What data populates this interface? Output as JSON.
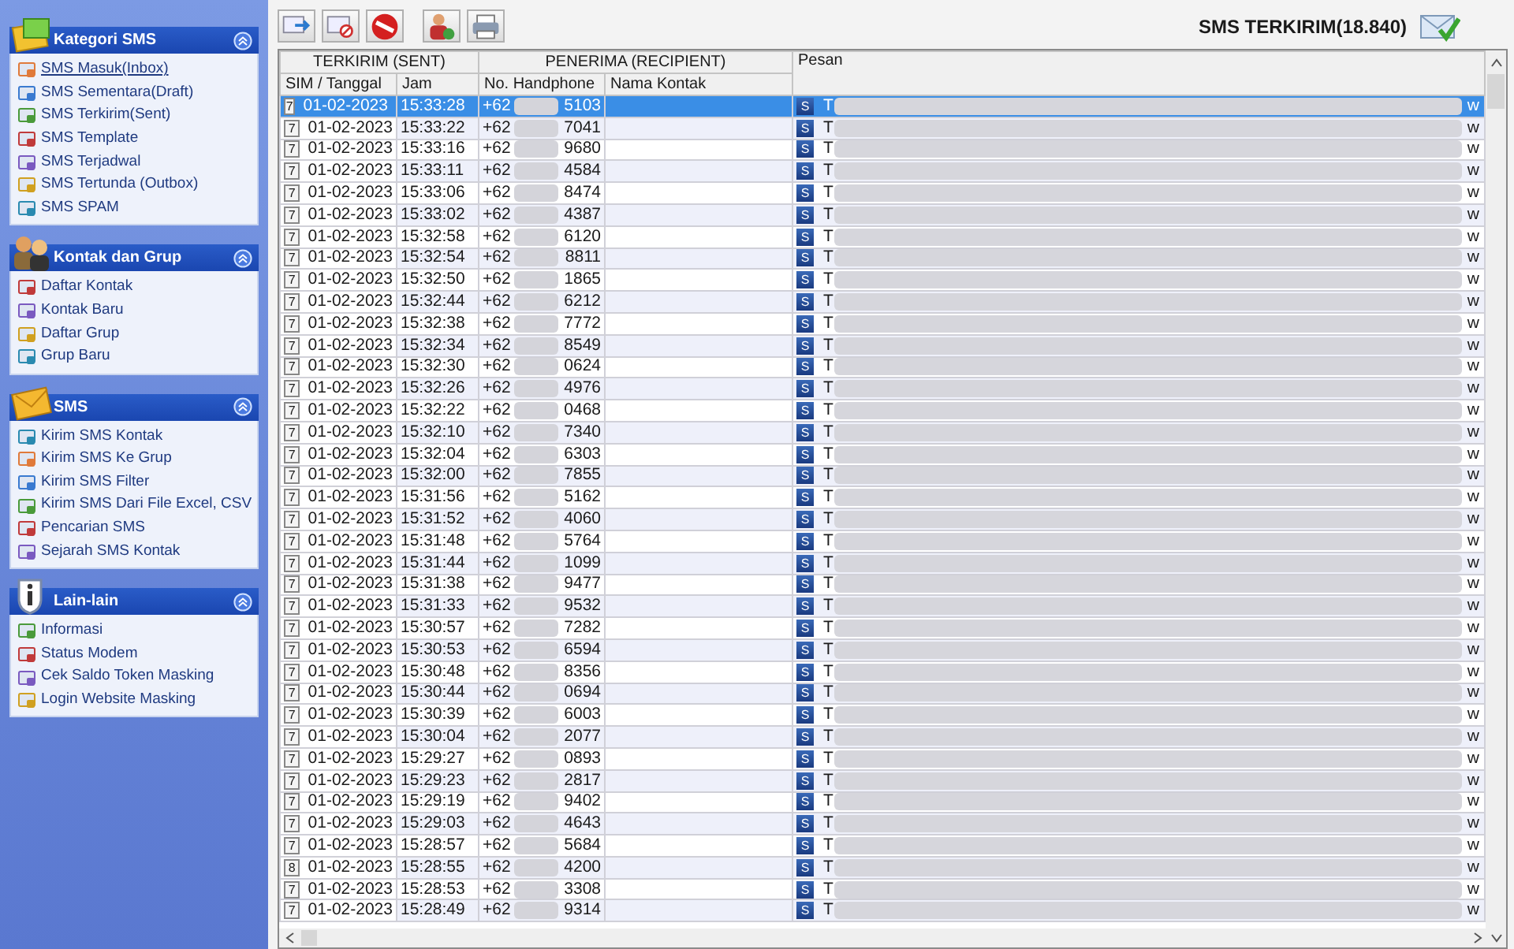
{
  "sidebar": {
    "sections": [
      {
        "title": "Kategori SMS",
        "expanded": true,
        "items": [
          {
            "label": "SMS Masuk(Inbox)",
            "selected": true
          },
          {
            "label": "SMS Sementara(Draft)",
            "selected": false
          },
          {
            "label": "SMS Terkirim(Sent)",
            "selected": false
          },
          {
            "label": "SMS Template",
            "selected": false
          },
          {
            "label": "SMS Terjadwal",
            "selected": false
          },
          {
            "label": "SMS Tertunda (Outbox)",
            "selected": false
          },
          {
            "label": "SMS SPAM",
            "selected": false
          }
        ]
      },
      {
        "title": "Kontak dan Grup",
        "expanded": true,
        "items": [
          {
            "label": "Daftar Kontak",
            "selected": false
          },
          {
            "label": "Kontak Baru",
            "selected": false
          },
          {
            "label": "Daftar Grup",
            "selected": false
          },
          {
            "label": "Grup Baru",
            "selected": false
          }
        ]
      },
      {
        "title": "SMS",
        "expanded": true,
        "items": [
          {
            "label": "Kirim SMS Kontak",
            "selected": false
          },
          {
            "label": "Kirim SMS Ke Grup",
            "selected": false
          },
          {
            "label": "Kirim SMS Filter",
            "selected": false
          },
          {
            "label": "Kirim SMS Dari File Excel, CSV",
            "selected": false
          },
          {
            "label": "Pencarian SMS",
            "selected": false
          },
          {
            "label": "Sejarah SMS Kontak",
            "selected": false
          }
        ]
      },
      {
        "title": "Lain-lain",
        "expanded": true,
        "items": [
          {
            "label": "Informasi",
            "selected": false
          },
          {
            "label": "Status Modem",
            "selected": false
          },
          {
            "label": "Cek Saldo Token Masking",
            "selected": false
          },
          {
            "label": "Login Website Masking",
            "selected": false
          }
        ]
      }
    ]
  },
  "header": {
    "title": "SMS TERKIRIM(18.840)"
  },
  "table": {
    "groups": [
      "TERKIRIM (SENT)",
      "PENERIMA (RECIPIENT)"
    ],
    "columns": [
      "SIM / Tanggal",
      "Jam",
      "No. Handphone",
      "Nama Kontak",
      "Pesan"
    ],
    "rows": [
      {
        "sim": "7",
        "date": "01-02-2023",
        "time": "15:33:28",
        "phone_start": "+62",
        "phone_end": "5103",
        "badge": "S",
        "message_start": "T",
        "message_end": "w",
        "selected": true
      },
      {
        "sim": "7",
        "date": "01-02-2023",
        "time": "15:33:22",
        "phone_start": "+62",
        "phone_end": "7041",
        "badge": "S",
        "message_start": "T",
        "message_end": "w",
        "selected": false
      },
      {
        "sim": "7",
        "date": "01-02-2023",
        "time": "15:33:16",
        "phone_start": "+62",
        "phone_end": "9680",
        "badge": "S",
        "message_start": "T",
        "message_end": "w",
        "selected": false
      },
      {
        "sim": "7",
        "date": "01-02-2023",
        "time": "15:33:11",
        "phone_start": "+62",
        "phone_end": "4584",
        "badge": "S",
        "message_start": "T",
        "message_end": "w",
        "selected": false
      },
      {
        "sim": "7",
        "date": "01-02-2023",
        "time": "15:33:06",
        "phone_start": "+62",
        "phone_end": "8474",
        "badge": "S",
        "message_start": "T",
        "message_end": "w",
        "selected": false
      },
      {
        "sim": "7",
        "date": "01-02-2023",
        "time": "15:33:02",
        "phone_start": "+62",
        "phone_end": "4387",
        "badge": "S",
        "message_start": "T",
        "message_end": "w",
        "selected": false
      },
      {
        "sim": "7",
        "date": "01-02-2023",
        "time": "15:32:58",
        "phone_start": "+62",
        "phone_end": "6120",
        "badge": "S",
        "message_start": "T",
        "message_end": "w",
        "selected": false
      },
      {
        "sim": "7",
        "date": "01-02-2023",
        "time": "15:32:54",
        "phone_start": "+62",
        "phone_end": "8811",
        "badge": "S",
        "message_start": "T",
        "message_end": "w",
        "selected": false
      },
      {
        "sim": "7",
        "date": "01-02-2023",
        "time": "15:32:50",
        "phone_start": "+62",
        "phone_end": "1865",
        "badge": "S",
        "message_start": "T",
        "message_end": "w",
        "selected": false
      },
      {
        "sim": "7",
        "date": "01-02-2023",
        "time": "15:32:44",
        "phone_start": "+62",
        "phone_end": "6212",
        "badge": "S",
        "message_start": "T",
        "message_end": "w",
        "selected": false
      },
      {
        "sim": "7",
        "date": "01-02-2023",
        "time": "15:32:38",
        "phone_start": "+62",
        "phone_end": "7772",
        "badge": "S",
        "message_start": "T",
        "message_end": "w",
        "selected": false
      },
      {
        "sim": "7",
        "date": "01-02-2023",
        "time": "15:32:34",
        "phone_start": "+62",
        "phone_end": "8549",
        "badge": "S",
        "message_start": "T",
        "message_end": "w",
        "selected": false
      },
      {
        "sim": "7",
        "date": "01-02-2023",
        "time": "15:32:30",
        "phone_start": "+62",
        "phone_end": "0624",
        "badge": "S",
        "message_start": "T",
        "message_end": "w",
        "selected": false
      },
      {
        "sim": "7",
        "date": "01-02-2023",
        "time": "15:32:26",
        "phone_start": "+62",
        "phone_end": "4976",
        "badge": "S",
        "message_start": "T",
        "message_end": "w",
        "selected": false
      },
      {
        "sim": "7",
        "date": "01-02-2023",
        "time": "15:32:22",
        "phone_start": "+62",
        "phone_end": "0468",
        "badge": "S",
        "message_start": "T",
        "message_end": "w",
        "selected": false
      },
      {
        "sim": "7",
        "date": "01-02-2023",
        "time": "15:32:10",
        "phone_start": "+62",
        "phone_end": "7340",
        "badge": "S",
        "message_start": "T",
        "message_end": "w",
        "selected": false
      },
      {
        "sim": "7",
        "date": "01-02-2023",
        "time": "15:32:04",
        "phone_start": "+62",
        "phone_end": "6303",
        "badge": "S",
        "message_start": "T",
        "message_end": "w",
        "selected": false
      },
      {
        "sim": "7",
        "date": "01-02-2023",
        "time": "15:32:00",
        "phone_start": "+62",
        "phone_end": "7855",
        "badge": "S",
        "message_start": "T",
        "message_end": "w",
        "selected": false
      },
      {
        "sim": "7",
        "date": "01-02-2023",
        "time": "15:31:56",
        "phone_start": "+62",
        "phone_end": "5162",
        "badge": "S",
        "message_start": "T",
        "message_end": "w",
        "selected": false
      },
      {
        "sim": "7",
        "date": "01-02-2023",
        "time": "15:31:52",
        "phone_start": "+62",
        "phone_end": "4060",
        "badge": "S",
        "message_start": "T",
        "message_end": "w",
        "selected": false
      },
      {
        "sim": "7",
        "date": "01-02-2023",
        "time": "15:31:48",
        "phone_start": "+62",
        "phone_end": "5764",
        "badge": "S",
        "message_start": "T",
        "message_end": "w",
        "selected": false
      },
      {
        "sim": "7",
        "date": "01-02-2023",
        "time": "15:31:44",
        "phone_start": "+62",
        "phone_end": "1099",
        "badge": "S",
        "message_start": "T",
        "message_end": "w",
        "selected": false
      },
      {
        "sim": "7",
        "date": "01-02-2023",
        "time": "15:31:38",
        "phone_start": "+62",
        "phone_end": "9477",
        "badge": "S",
        "message_start": "T",
        "message_end": "w",
        "selected": false
      },
      {
        "sim": "7",
        "date": "01-02-2023",
        "time": "15:31:33",
        "phone_start": "+62",
        "phone_end": "9532",
        "badge": "S",
        "message_start": "T",
        "message_end": "w",
        "selected": false
      },
      {
        "sim": "7",
        "date": "01-02-2023",
        "time": "15:30:57",
        "phone_start": "+62",
        "phone_end": "7282",
        "badge": "S",
        "message_start": "T",
        "message_end": "w",
        "selected": false
      },
      {
        "sim": "7",
        "date": "01-02-2023",
        "time": "15:30:53",
        "phone_start": "+62",
        "phone_end": "6594",
        "badge": "S",
        "message_start": "T",
        "message_end": "w",
        "selected": false
      },
      {
        "sim": "7",
        "date": "01-02-2023",
        "time": "15:30:48",
        "phone_start": "+62",
        "phone_end": "8356",
        "badge": "S",
        "message_start": "T",
        "message_end": "w",
        "selected": false
      },
      {
        "sim": "7",
        "date": "01-02-2023",
        "time": "15:30:44",
        "phone_start": "+62",
        "phone_end": "0694",
        "badge": "S",
        "message_start": "T",
        "message_end": "w",
        "selected": false
      },
      {
        "sim": "7",
        "date": "01-02-2023",
        "time": "15:30:39",
        "phone_start": "+62",
        "phone_end": "6003",
        "badge": "S",
        "message_start": "T",
        "message_end": "w",
        "selected": false
      },
      {
        "sim": "7",
        "date": "01-02-2023",
        "time": "15:30:04",
        "phone_start": "+62",
        "phone_end": "2077",
        "badge": "S",
        "message_start": "T",
        "message_end": "w",
        "selected": false
      },
      {
        "sim": "7",
        "date": "01-02-2023",
        "time": "15:29:27",
        "phone_start": "+62",
        "phone_end": "0893",
        "badge": "S",
        "message_start": "T",
        "message_end": "w",
        "selected": false
      },
      {
        "sim": "7",
        "date": "01-02-2023",
        "time": "15:29:23",
        "phone_start": "+62",
        "phone_end": "2817",
        "badge": "S",
        "message_start": "T",
        "message_end": "w",
        "selected": false
      },
      {
        "sim": "7",
        "date": "01-02-2023",
        "time": "15:29:19",
        "phone_start": "+62",
        "phone_end": "9402",
        "badge": "S",
        "message_start": "T",
        "message_end": "w",
        "selected": false
      },
      {
        "sim": "7",
        "date": "01-02-2023",
        "time": "15:29:03",
        "phone_start": "+62",
        "phone_end": "4643",
        "badge": "S",
        "message_start": "T",
        "message_end": "w",
        "selected": false
      },
      {
        "sim": "7",
        "date": "01-02-2023",
        "time": "15:28:57",
        "phone_start": "+62",
        "phone_end": "5684",
        "badge": "S",
        "message_start": "T",
        "message_end": "w",
        "selected": false
      },
      {
        "sim": "8",
        "date": "01-02-2023",
        "time": "15:28:55",
        "phone_start": "+62",
        "phone_end": "4200",
        "badge": "S",
        "message_start": "T",
        "message_end": "w",
        "selected": false
      },
      {
        "sim": "7",
        "date": "01-02-2023",
        "time": "15:28:53",
        "phone_start": "+62",
        "phone_end": "3308",
        "badge": "S",
        "message_start": "T",
        "message_end": "w",
        "selected": false
      },
      {
        "sim": "7",
        "date": "01-02-2023",
        "time": "15:28:49",
        "phone_start": "+62",
        "phone_end": "9314",
        "badge": "S",
        "message_start": "T",
        "message_end": "w",
        "selected": false
      }
    ]
  }
}
